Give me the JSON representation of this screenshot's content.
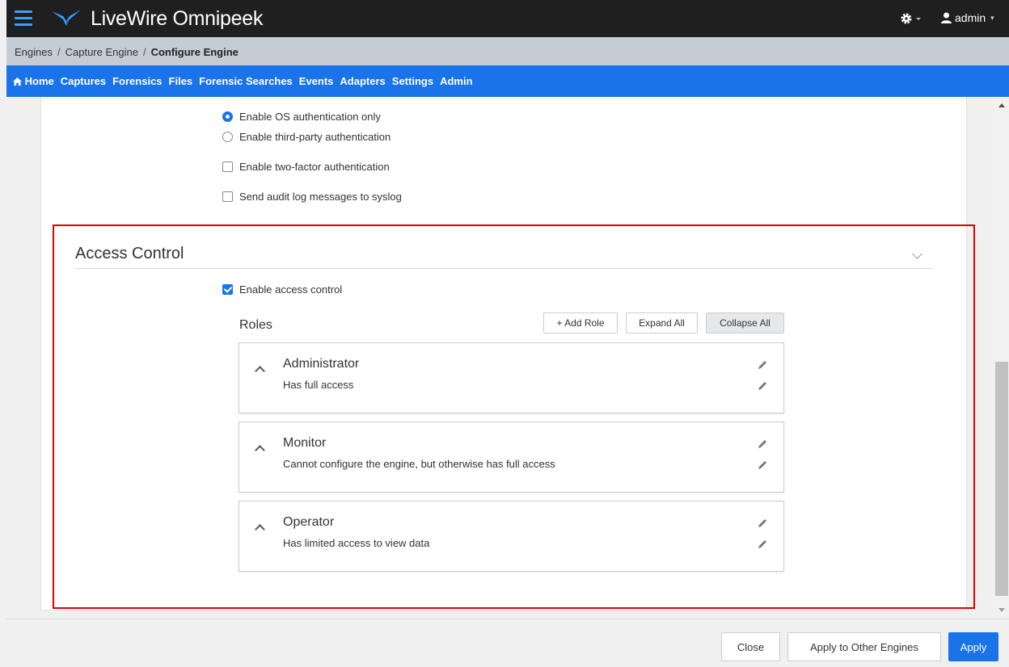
{
  "app": {
    "title": "LiveWire Omnipeek",
    "user": "admin"
  },
  "header_icons": {
    "menu": "hamburger-menu-icon",
    "logo": "bird-logo-icon",
    "settings": "gear-icon",
    "user": "user-icon"
  },
  "breadcrumb": [
    "Engines",
    "Capture Engine",
    "Configure Engine"
  ],
  "nav": {
    "home": "Home",
    "items": [
      "Captures",
      "Forensics",
      "Files",
      "Forensic Searches",
      "Events",
      "Adapters",
      "Settings",
      "Admin"
    ]
  },
  "auth": {
    "radio_os": "Enable OS authentication only",
    "radio_third_party": "Enable third-party authentication",
    "selected": "os",
    "two_factor": "Enable two-factor authentication",
    "two_factor_checked": false,
    "syslog": "Send audit log messages to syslog",
    "syslog_checked": false
  },
  "access_control": {
    "title": "Access Control",
    "enable_label": "Enable access control",
    "enabled": true,
    "roles_title": "Roles",
    "buttons": {
      "add_role": "+ Add Role",
      "expand_all": "Expand All",
      "collapse_all": "Collapse All"
    },
    "roles": [
      {
        "name": "Administrator",
        "description": "Has full access"
      },
      {
        "name": "Monitor",
        "description": "Cannot configure the engine, but otherwise has full access"
      },
      {
        "name": "Operator",
        "description": "Has limited access to view data"
      }
    ]
  },
  "footer": {
    "close": "Close",
    "apply_other": "Apply to Other Engines",
    "apply": "Apply"
  },
  "colors": {
    "accent": "#1a73e8",
    "topbar": "#1f1f1f",
    "breadcrumb_bg": "#c4ccd4",
    "highlight": "#e00000"
  }
}
